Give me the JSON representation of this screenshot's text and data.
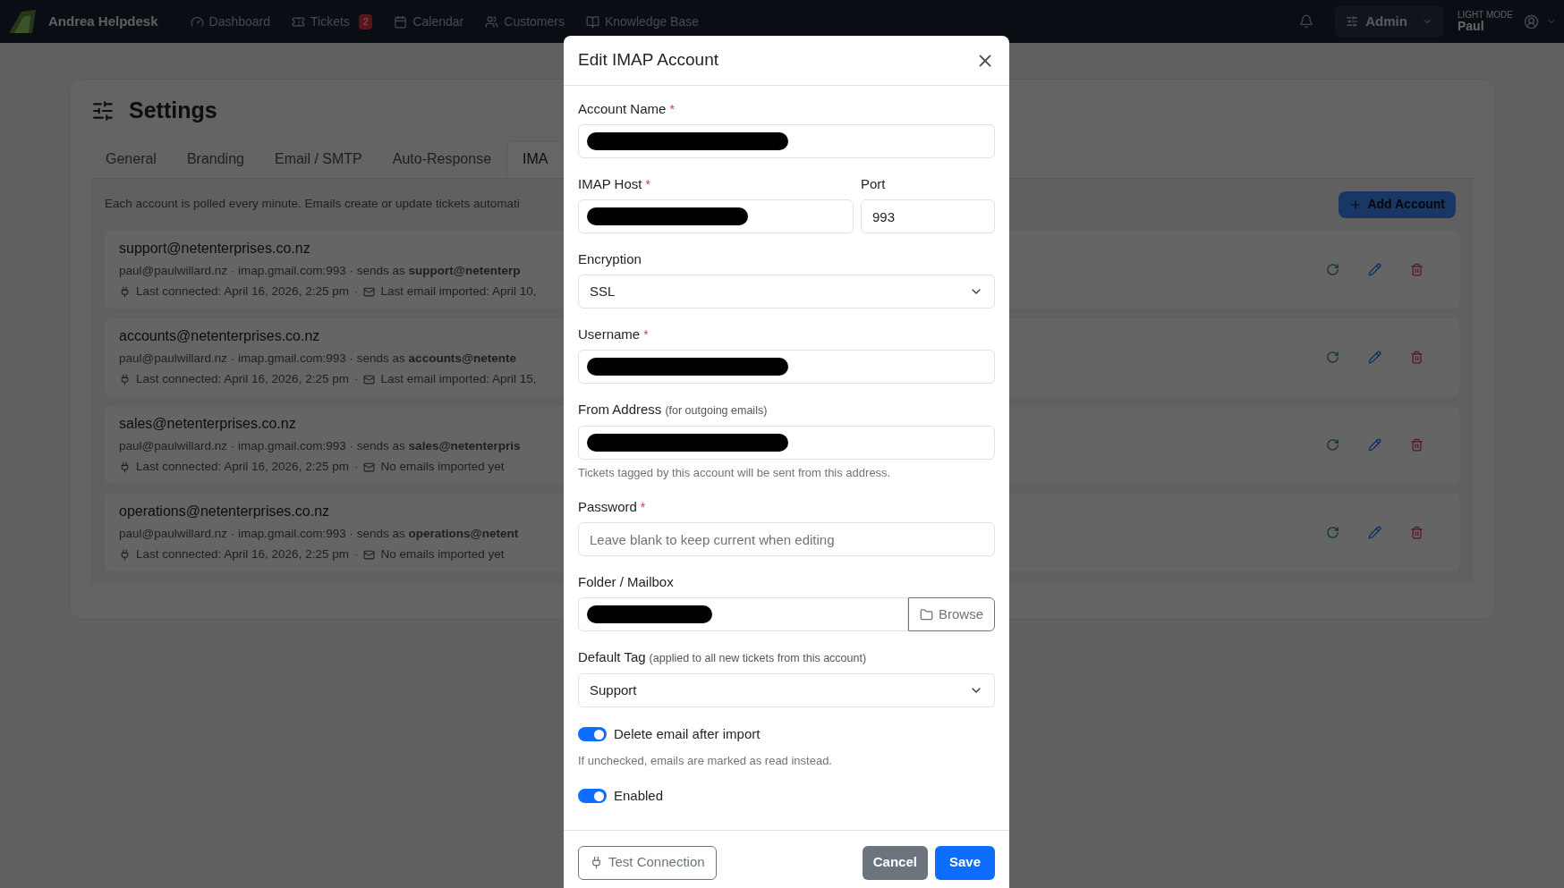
{
  "nav": {
    "brand": "Andrea Helpdesk",
    "items": [
      {
        "label": "Dashboard"
      },
      {
        "label": "Tickets",
        "badge": "2"
      },
      {
        "label": "Calendar"
      },
      {
        "label": "Customers"
      },
      {
        "label": "Knowledge Base"
      }
    ],
    "role": "Admin",
    "mode_label": "LIGHT MODE",
    "user": "Paul"
  },
  "settings": {
    "title": "Settings",
    "tabs": [
      {
        "label": "General",
        "selected": false
      },
      {
        "label": "Branding",
        "selected": false
      },
      {
        "label": "Email / SMTP",
        "selected": false
      },
      {
        "label": "Auto-Response",
        "selected": false
      },
      {
        "label": "IMA",
        "selected": true
      }
    ],
    "intro": "Each account is polled every minute. Emails create or update tickets automati",
    "add_button": "Add Account",
    "accounts": [
      {
        "email": "support@netenterprises.co.nz",
        "details": "paul@paulwillard.nz · imap.gmail.com:993 · sends as **support@netenterp**",
        "last_connected": "Last connected: April 16, 2026, 2:25 pm",
        "separator": "·",
        "last_import": "Last email imported: April 10,"
      },
      {
        "email": "accounts@netenterprises.co.nz",
        "details": "paul@paulwillard.nz · imap.gmail.com:993 · sends as **accounts@netente**",
        "last_connected": "Last connected: April 16, 2026, 2:25 pm",
        "separator": "·",
        "last_import": "Last email imported: April 15,"
      },
      {
        "email": "sales@netenterprises.co.nz",
        "details": "paul@paulwillard.nz · imap.gmail.com:993 · sends as **sales@netenterpris**",
        "last_connected": "Last connected: April 16, 2026, 2:25 pm",
        "separator": "·",
        "last_import": "No emails imported yet"
      },
      {
        "email": "operations@netenterprises.co.nz",
        "details": "paul@paulwillard.nz · imap.gmail.com:993 · sends as **operations@netent**",
        "last_connected": "Last connected: April 16, 2026, 2:25 pm",
        "separator": "·",
        "last_import": "No emails imported yet"
      }
    ]
  },
  "modal": {
    "title": "Edit IMAP Account",
    "fields": [
      {
        "kind": "text",
        "label": "Account Name",
        "required_mark": "*",
        "redacted": true
      },
      {
        "kind": "pair",
        "items": [
          {
            "label": "IMAP Host",
            "required_mark": "*",
            "redacted": true
          },
          {
            "label": "Port",
            "value": "993"
          }
        ]
      },
      {
        "kind": "select",
        "label": "Encryption",
        "value": "SSL"
      },
      {
        "kind": "text",
        "label": "Username",
        "required_mark": "*",
        "redacted": true
      },
      {
        "kind": "text",
        "label": "From Address",
        "note": "(for outgoing emails)",
        "redacted": true,
        "help": "Tickets tagged by this account will be sent from this address."
      },
      {
        "kind": "text",
        "label": "Password",
        "required_mark": "*",
        "placeholder": "Leave blank to keep current when editing"
      },
      {
        "kind": "browse",
        "label": "Folder / Mailbox",
        "redacted": true,
        "button": "Browse"
      },
      {
        "kind": "select",
        "label": "Default Tag",
        "note": "(applied to all new tickets from this account)",
        "value": "Support"
      },
      {
        "kind": "toggle",
        "label": "Delete email after import",
        "on": true,
        "help": "If unchecked, emails are marked as read instead."
      },
      {
        "kind": "toggle",
        "label": "Enabled",
        "on": true
      }
    ],
    "test_button": "Test Connection",
    "cancel_button": "Cancel",
    "save_button": "Save"
  }
}
